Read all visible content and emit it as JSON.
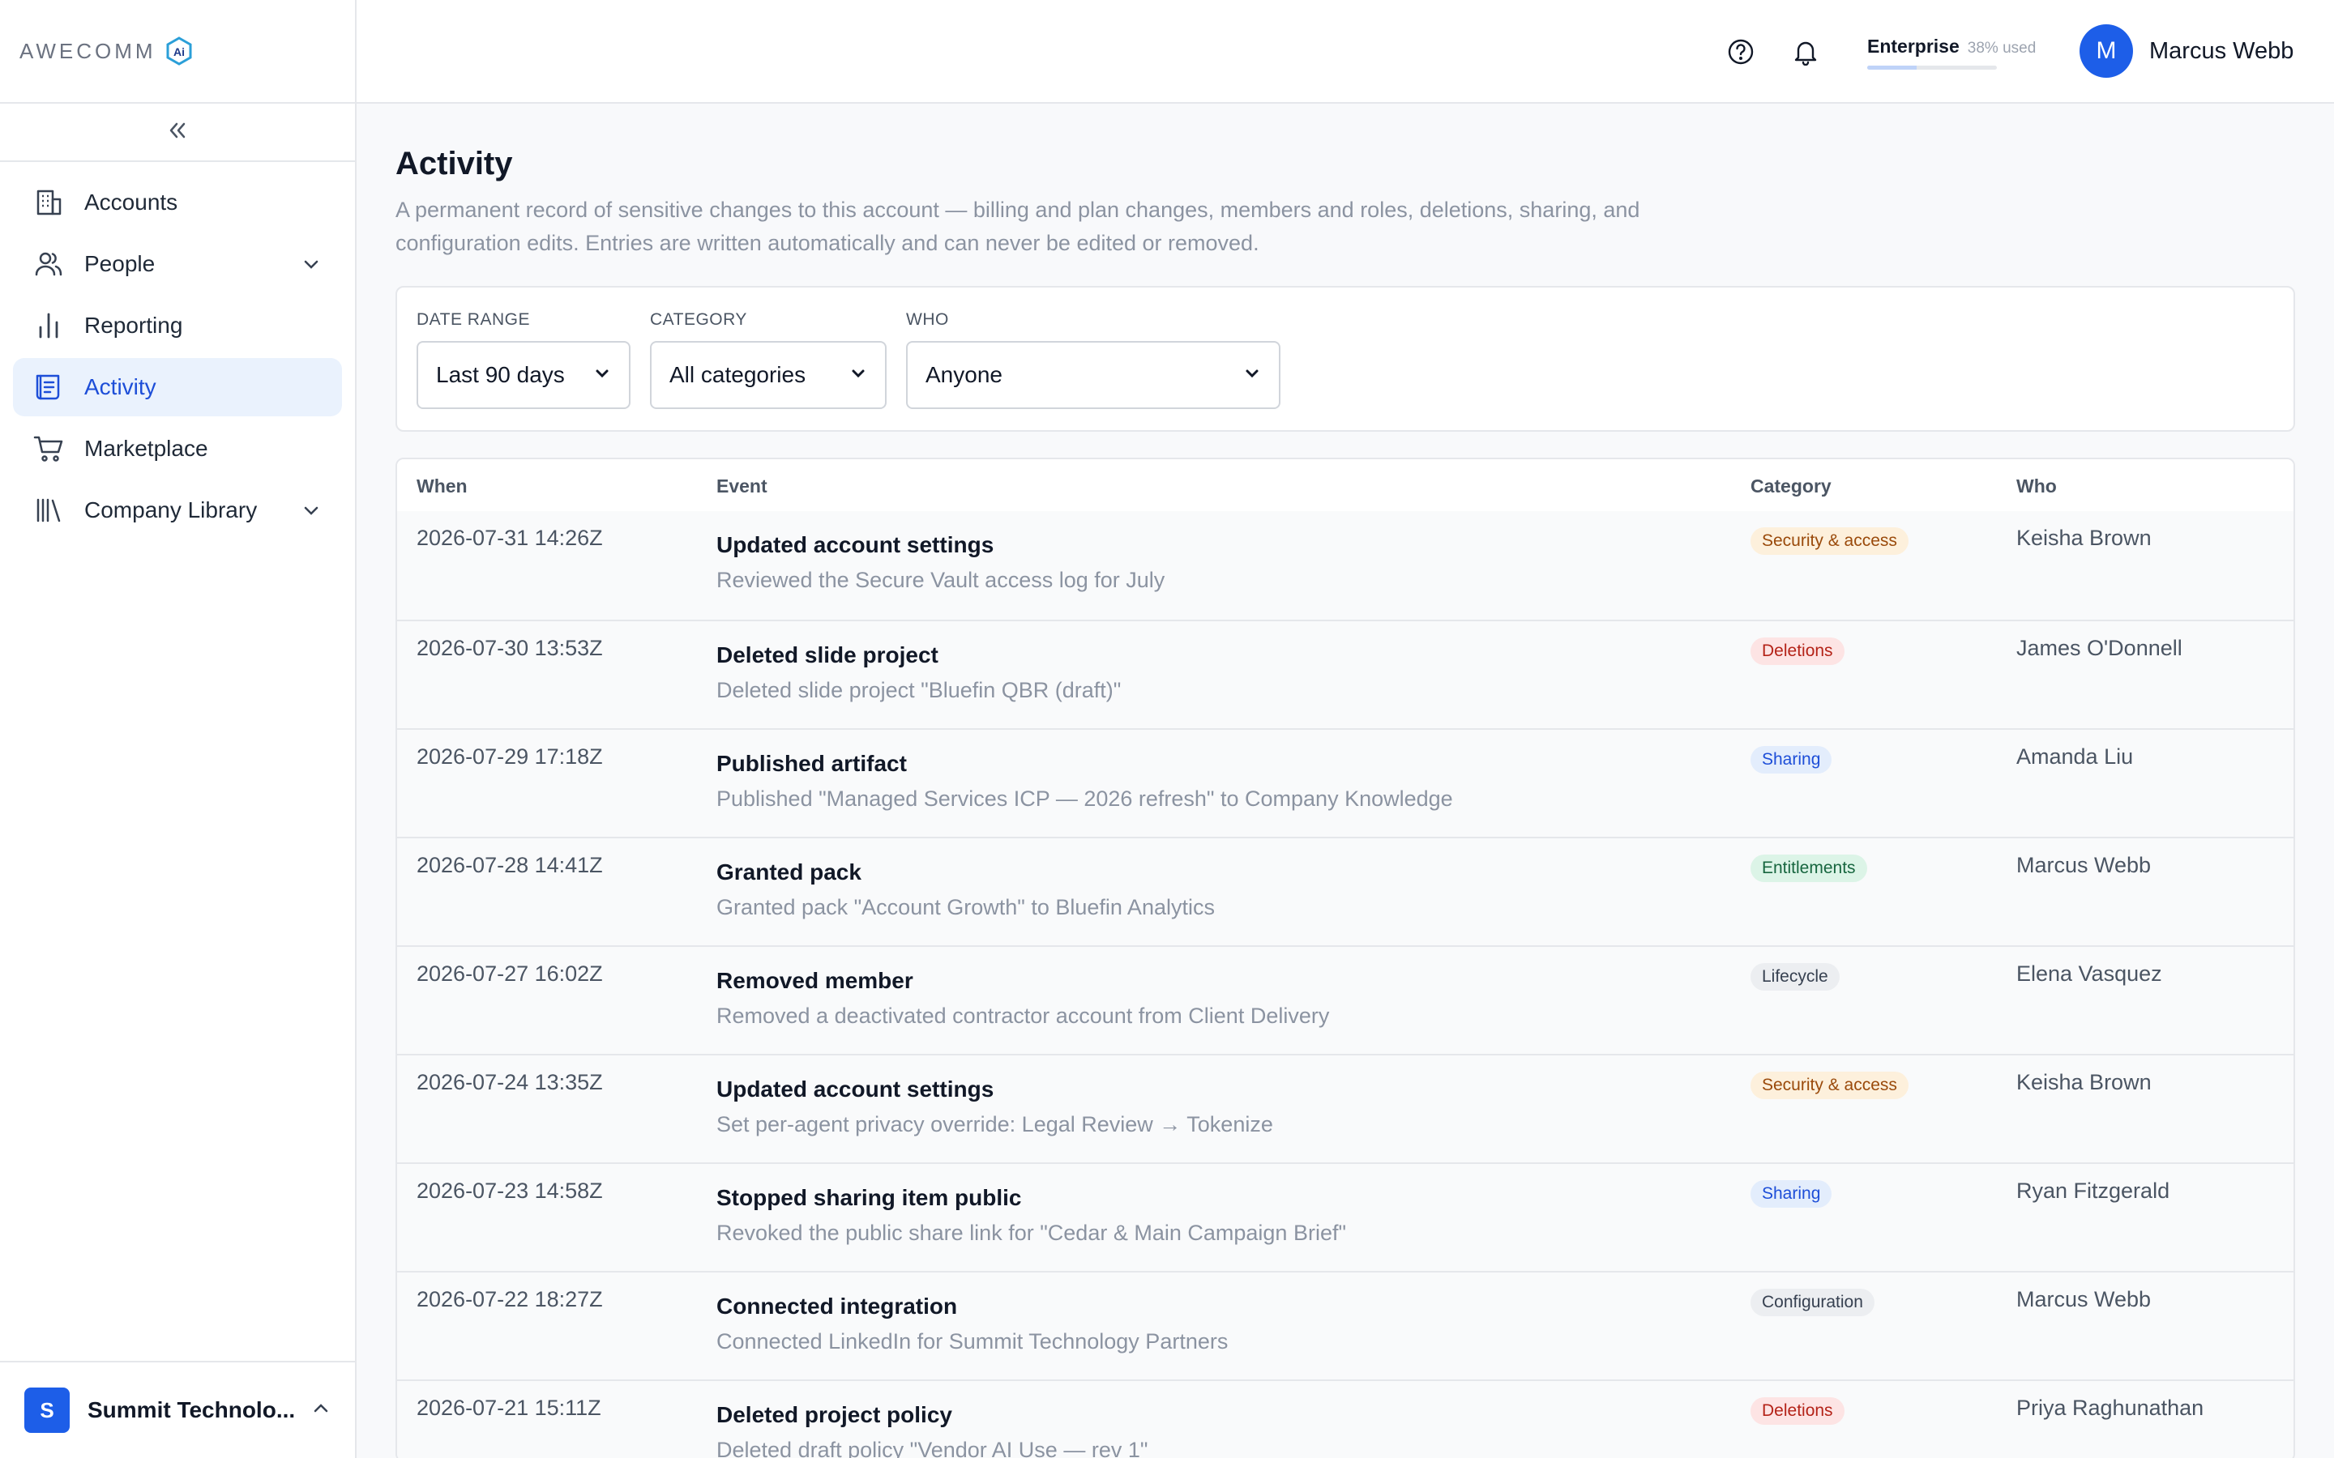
{
  "brand": {
    "logo_text": "AWECOMM",
    "logo_badge": "Ai"
  },
  "sidebar": {
    "items": [
      {
        "label": "Accounts",
        "icon": "building-icon",
        "expandable": false,
        "active": false
      },
      {
        "label": "People",
        "icon": "people-icon",
        "expandable": true,
        "active": false
      },
      {
        "label": "Reporting",
        "icon": "bar-chart-icon",
        "expandable": false,
        "active": false
      },
      {
        "label": "Activity",
        "icon": "scroll-log-icon",
        "expandable": false,
        "active": true
      },
      {
        "label": "Marketplace",
        "icon": "cart-icon",
        "expandable": false,
        "active": false
      },
      {
        "label": "Company Library",
        "icon": "library-icon",
        "expandable": true,
        "active": false
      }
    ],
    "org": {
      "initial": "S",
      "name": "Summit Technolo..."
    }
  },
  "topbar": {
    "plan_name": "Enterprise",
    "plan_used": "38% used",
    "plan_fraction": 0.38,
    "user_initial": "M",
    "user_name": "Marcus Webb"
  },
  "page": {
    "title": "Activity",
    "description": "A permanent record of sensitive changes to this account — billing and plan changes, members and roles, deletions, sharing, and configuration edits. Entries are written automatically and can never be edited or removed."
  },
  "filters": {
    "date_range": {
      "label": "DATE RANGE",
      "value": "Last 90 days"
    },
    "category": {
      "label": "CATEGORY",
      "value": "All categories"
    },
    "who": {
      "label": "WHO",
      "value": "Anyone"
    }
  },
  "table": {
    "headers": {
      "when": "When",
      "event": "Event",
      "category": "Category",
      "who": "Who"
    },
    "rows": [
      {
        "when": "2026-07-31 14:26Z",
        "title": "Updated account settings",
        "detail": "Reviewed the Secure Vault access log for July",
        "category": "Security & access",
        "who": "Keisha Brown"
      },
      {
        "when": "2026-07-30 13:53Z",
        "title": "Deleted slide project",
        "detail": "Deleted slide project \"Bluefin QBR (draft)\"",
        "category": "Deletions",
        "who": "James O'Donnell"
      },
      {
        "when": "2026-07-29 17:18Z",
        "title": "Published artifact",
        "detail": "Published \"Managed Services ICP — 2026 refresh\" to Company Knowledge",
        "category": "Sharing",
        "who": "Amanda Liu"
      },
      {
        "when": "2026-07-28 14:41Z",
        "title": "Granted pack",
        "detail": "Granted pack \"Account Growth\" to Bluefin Analytics",
        "category": "Entitlements",
        "who": "Marcus Webb"
      },
      {
        "when": "2026-07-27 16:02Z",
        "title": "Removed member",
        "detail": "Removed a deactivated contractor account from Client Delivery",
        "category": "Lifecycle",
        "who": "Elena Vasquez"
      },
      {
        "when": "2026-07-24 13:35Z",
        "title": "Updated account settings",
        "detail": "Set per-agent privacy override: Legal Review → Tokenize",
        "category": "Security & access",
        "who": "Keisha Brown"
      },
      {
        "when": "2026-07-23 14:58Z",
        "title": "Stopped sharing item public",
        "detail": "Revoked the public share link for \"Cedar & Main Campaign Brief\"",
        "category": "Sharing",
        "who": "Ryan Fitzgerald"
      },
      {
        "when": "2026-07-22 18:27Z",
        "title": "Connected integration",
        "detail": "Connected LinkedIn for Summit Technology Partners",
        "category": "Configuration",
        "who": "Marcus Webb"
      },
      {
        "when": "2026-07-21 15:11Z",
        "title": "Deleted project policy",
        "detail": "Deleted draft policy \"Vendor AI Use — rev 1\"",
        "category": "Deletions",
        "who": "Priya Raghunathan"
      }
    ]
  },
  "category_colors": {
    "Security & access": {
      "bg": "#fdf0dc",
      "fg": "#9a4a0b"
    },
    "Deletions": {
      "bg": "#fde4e4",
      "fg": "#b42318"
    },
    "Sharing": {
      "bg": "#e3edfc",
      "fg": "#1d4ed8"
    },
    "Entitlements": {
      "bg": "#dcf4e7",
      "fg": "#17663f"
    },
    "Lifecycle": {
      "bg": "#eceef1",
      "fg": "#374151"
    },
    "Configuration": {
      "bg": "#eceef1",
      "fg": "#374151"
    }
  }
}
